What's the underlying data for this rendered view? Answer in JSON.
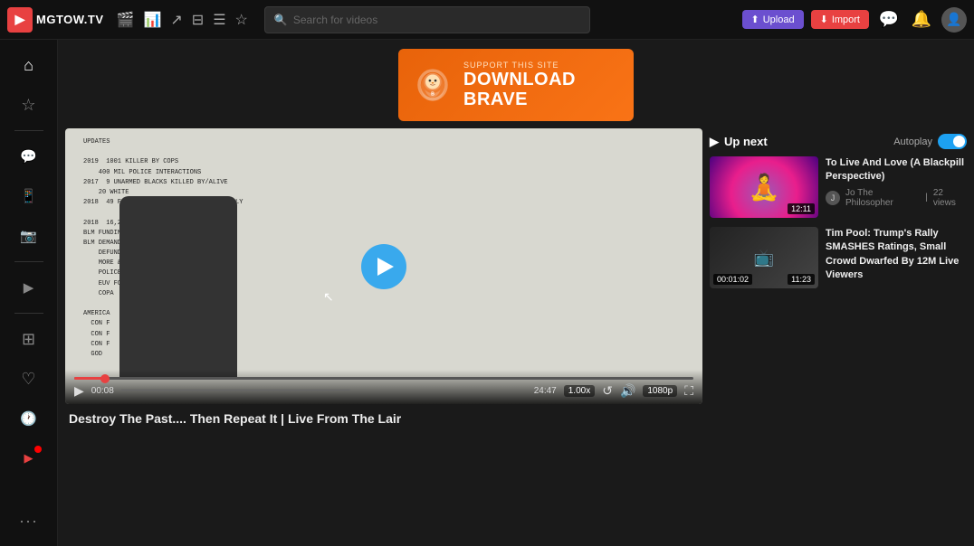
{
  "topbar": {
    "logo_text": "MGTOW.TV",
    "search_placeholder": "Search for videos",
    "upload_label": "Upload",
    "import_label": "Import"
  },
  "ad": {
    "support_text": "Support This Site",
    "download_text": "DOWNLOAD BRAVE"
  },
  "video": {
    "title": "Destroy The Past.... Then Repeat It | Live From The Lair",
    "current_time": "00:08",
    "total_time": "24:47",
    "speed": "1.00x",
    "quality": "1080p",
    "whiteboard_content": "UPDATES\n\n2019  1001 KILLER BY COPS\n    400 MIL POLICE INTERACTIONS\n2017  9 UNARMED BLACKS KILLED BY/ALIVE\n    20 WHITE\n2018  49 FATAL OFFIC              ANNUALLY\n\n2018  16,214 HOM\nBLM FUNDING C\nBLM DEMANDS\n    DEFUND POLIC\n    MORE & BLACK\n    POLICEFREE AN\n    EUV FOR PO\n    COPA\n\nAMERICA\n  CON F\n  CON F\n  CON F\n  GOD"
  },
  "up_next": {
    "title": "Up next",
    "autoplay_label": "Autoplay",
    "cards": [
      {
        "title": "To Live And Love (A Blackpill Perspective)",
        "channel": "Jo The Philosopher",
        "views": "22 views",
        "duration": "12:11",
        "thumb_style": "purple"
      },
      {
        "title": "Tim Pool: Trump's Rally SMASHES Ratings, Small Crowd Dwarfed By 12M Live Viewers",
        "channel": "",
        "views": "",
        "duration": "11:23",
        "thumb_duration2": "00:01:02",
        "thumb_style": "dark"
      }
    ]
  },
  "sidebar": {
    "icons": [
      {
        "name": "home-icon",
        "symbol": "⌂"
      },
      {
        "name": "bookmark-icon",
        "symbol": "☆"
      },
      {
        "name": "bell-icon",
        "symbol": "🔔"
      },
      {
        "name": "messenger-icon",
        "symbol": "💬"
      },
      {
        "name": "whatsapp-icon",
        "symbol": "📱"
      },
      {
        "name": "instagram-icon",
        "symbol": "📷"
      },
      {
        "name": "play-icon",
        "symbol": "▶"
      },
      {
        "name": "apps-icon",
        "symbol": "⊞"
      },
      {
        "name": "heart-icon",
        "symbol": "♡"
      },
      {
        "name": "clock-icon",
        "symbol": "🕐"
      },
      {
        "name": "youtube-icon",
        "symbol": "▶"
      },
      {
        "name": "more-icon",
        "symbol": "···"
      }
    ]
  }
}
